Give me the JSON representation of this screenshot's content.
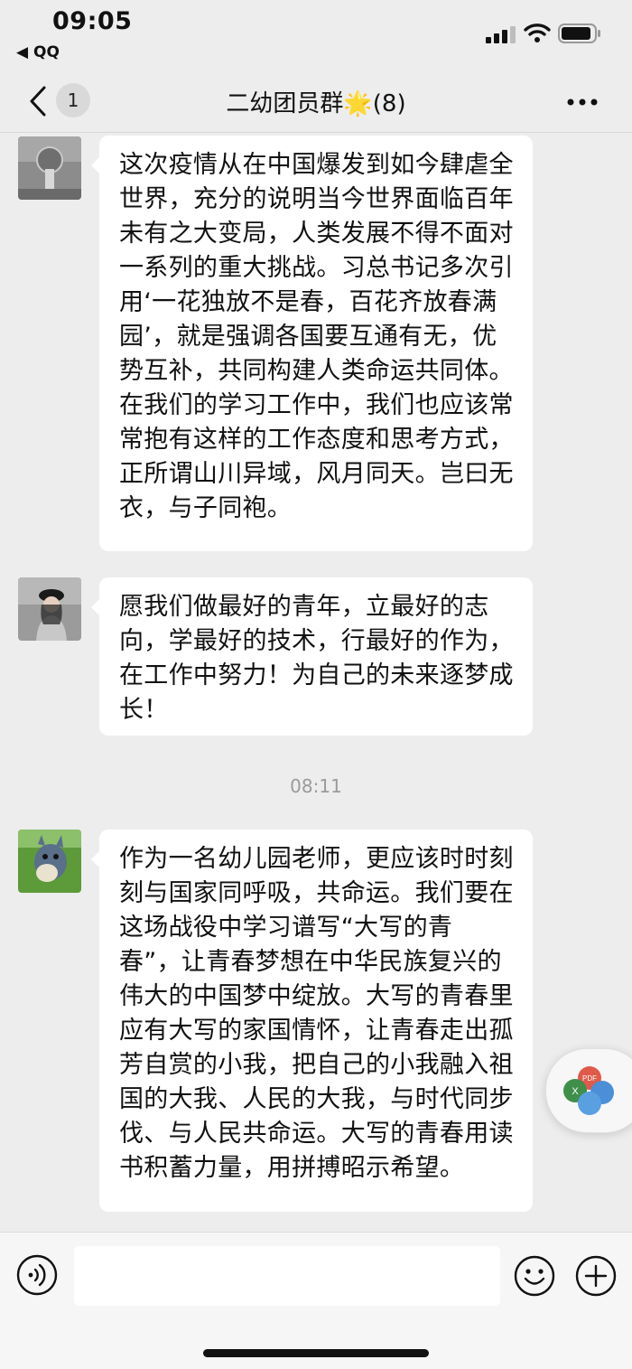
{
  "status_bar": {
    "time": "09:05",
    "back_app": "◀ QQ"
  },
  "nav": {
    "unread_count": "1",
    "title": "二幼团员群🌟(8)"
  },
  "messages": [
    {
      "type": "text",
      "avatar": "avatar-gray-photo",
      "text": "这次疫情从在中国爆发到如今肆虐全世界，充分的说明当今世界面临百年未有之大变局，人类发展不得不面对一系列的重大挑战。习总书记多次引用‘一花独放不是春，百花齐放春满园’，就是强调各国要互通有无，优势互补，共同构建人类命运共同体。在我们的学习工作中，我们也应该常常抱有这样的工作态度和思考方式，正所谓山川异域，风月同天。岂曰无衣，与子同袍。"
    },
    {
      "type": "text",
      "avatar": "avatar-woman-hat",
      "text": "愿我们做最好的青年，立最好的志向，学最好的技术，行最好的作为，在工作中努力！为自己的未来逐梦成长！"
    },
    {
      "type": "time",
      "text": "08:11"
    },
    {
      "type": "text",
      "avatar": "avatar-cartoon-cat",
      "text": "作为一名幼儿园老师，更应该时时刻刻与国家同呼吸，共命运。我们要在这场战役中学习谱写“大写的青春”，让青春梦想在中华民族复兴的伟大的中国梦中绽放。大写的青春里应有大写的家国情怀，让青春走出孤芳自赏的小我，把自己的小我融入祖国的大我、人民的大我，与时代同步伐、与人民共命运。大写的青春用读书积蓄力量，用拼搏昭示希望。"
    }
  ],
  "input": {
    "value": "",
    "placeholder": ""
  },
  "icons": [
    "signal-icon",
    "wifi-icon",
    "battery-icon",
    "back-chevron-icon",
    "more-icon",
    "voice-icon",
    "emoji-icon",
    "plus-icon",
    "file-tools-icon"
  ],
  "colors": {
    "background": "#ededed",
    "bubble": "#ffffff",
    "timestamp": "#9a9a9a"
  }
}
